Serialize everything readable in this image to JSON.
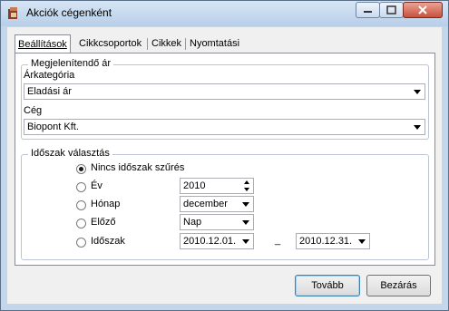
{
  "window": {
    "title": "Akciók cégenként"
  },
  "tabs": [
    {
      "label": "Beállítások"
    },
    {
      "label": "Cikkcsoportok"
    },
    {
      "label": "Cikkek"
    },
    {
      "label": "Nyomtatási beállítások"
    }
  ],
  "price_group": {
    "title": "Megjelenítendő ár",
    "category_label": "Árkategória",
    "category_value": "Eladási ár",
    "company_label": "Cég",
    "company_value": "Biopont Kft."
  },
  "period_group": {
    "title": "Időszak választás",
    "options": [
      {
        "label": "Nincs időszak szűrés",
        "checked": true
      },
      {
        "label": "Év",
        "checked": false
      },
      {
        "label": "Hónap",
        "checked": false
      },
      {
        "label": "Előző",
        "checked": false
      },
      {
        "label": "Időszak",
        "checked": false
      }
    ],
    "year_value": "2010",
    "month_value": "december",
    "previous_value": "Nap",
    "date_from": "2010.12.01.",
    "date_separator": "_",
    "date_to": "2010.12.31."
  },
  "buttons": {
    "next": "Tovább",
    "close": "Bezárás"
  }
}
